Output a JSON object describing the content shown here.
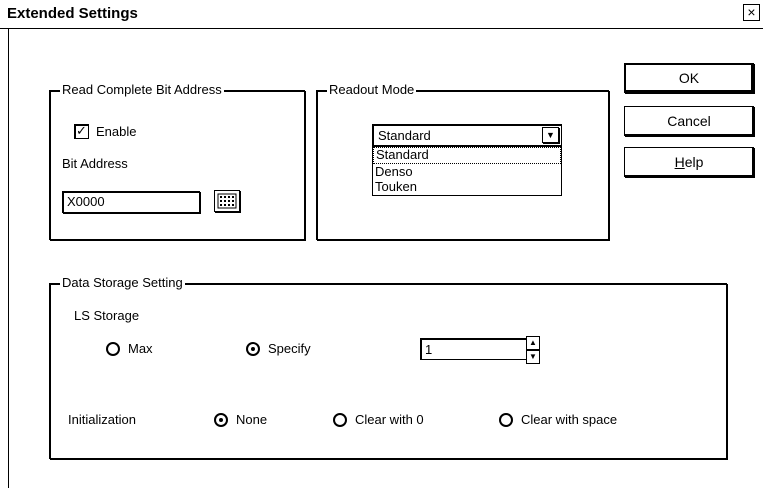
{
  "window": {
    "title": "Extended Settings",
    "close_glyph": "×"
  },
  "read_complete": {
    "legend": "Read Complete Bit Address",
    "enable_label": "Enable",
    "enable_checked": true,
    "bit_address_label": "Bit Address",
    "bit_address_value": "X0000"
  },
  "readout": {
    "legend": "Readout Mode",
    "selected": "Standard",
    "options": [
      "Standard",
      "Denso",
      "Touken"
    ]
  },
  "buttons": {
    "ok": "OK",
    "cancel": "Cancel",
    "help": "Help"
  },
  "storage": {
    "legend": "Data Storage Setting",
    "ls_storage_label": "LS Storage",
    "max_label": "Max",
    "specify_label": "Specify",
    "ls_selected": "Specify",
    "specify_value": "1",
    "initialization_label": "Initialization",
    "none_label": "None",
    "clear0_label": "Clear with 0",
    "clearspace_label": "Clear with space",
    "init_selected": "None"
  }
}
